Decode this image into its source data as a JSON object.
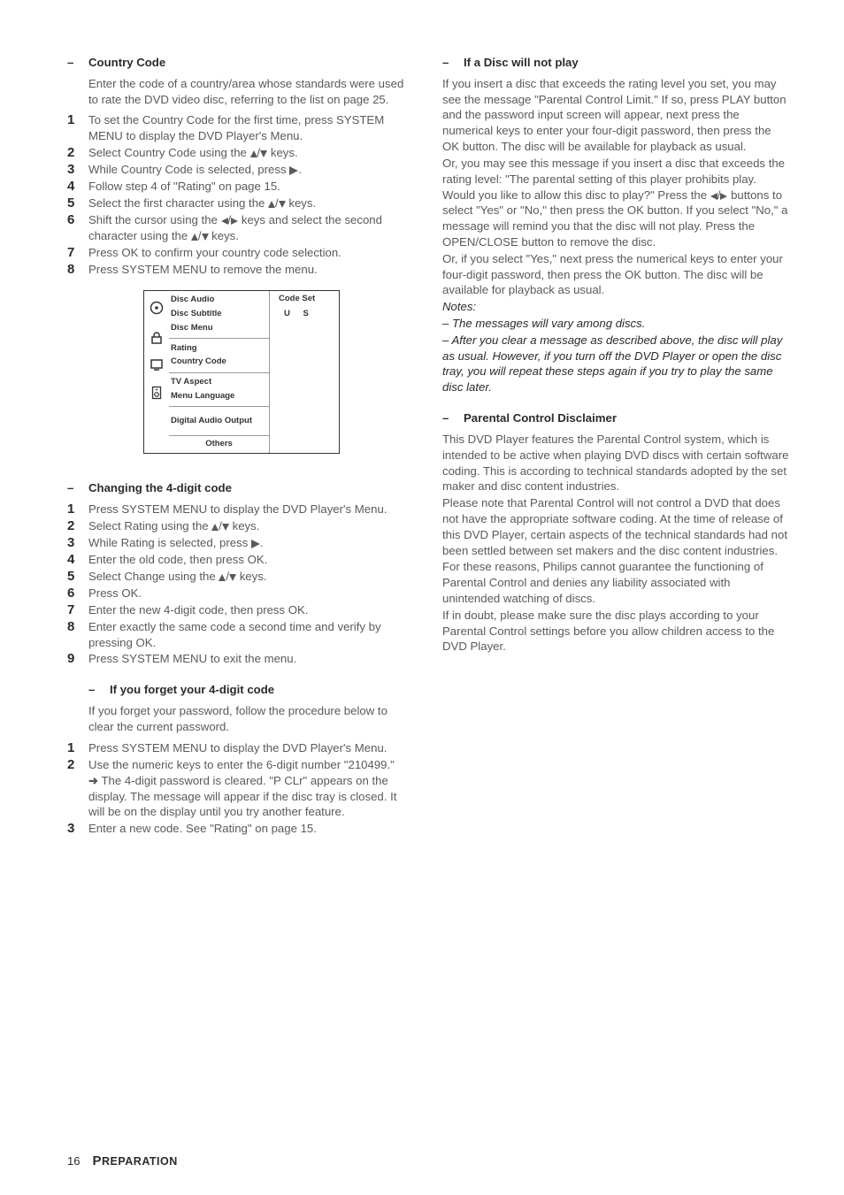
{
  "left": {
    "countryCode": {
      "heading": "Country Code",
      "intro": "Enter the code of a country/area whose standards were used to rate the DVD video disc, referring to the list  on page 25.",
      "steps": {
        "s1": "To set the Country Code for the first time, press SYSTEM MENU to display the DVD Player's Menu.",
        "s2a": "Select Country Code using the ",
        "s2b": " keys.",
        "s3a": "While Country Code is selected, press ",
        "s3b": ".",
        "s4": "Follow step 4 of \"Rating\" on page 15.",
        "s5a": "Select the first character using the ",
        "s5b": " keys.",
        "s6a": "Shift the cursor using the ",
        "s6b": " keys and select the second character using the ",
        "s6c": " keys.",
        "s7": "Press OK to confirm your country code selection.",
        "s8": "Press SYSTEM MENU to remove the menu."
      }
    },
    "menu": {
      "discAudio": "Disc Audio",
      "discSubtitle": "Disc Subtitle",
      "discMenu": "Disc Menu",
      "rating": "Rating",
      "countryCode": "Country Code",
      "tvAspect": "TV Aspect",
      "menuLanguage": "Menu Language",
      "digitalAudio": "Digital Audio Output",
      "others": "Others",
      "codeSet": "Code Set",
      "us": "U S"
    },
    "changing": {
      "heading": "Changing the 4-digit code",
      "s1": "Press SYSTEM MENU to display the DVD Player's Menu.",
      "s2a": "Select Rating using the ",
      "s2b": " keys.",
      "s3a": "While Rating is selected, press ",
      "s3b": ".",
      "s4": "Enter the old code, then press OK.",
      "s5a": "Select Change using the ",
      "s5b": " keys.",
      "s6": "Press OK.",
      "s7": "Enter the new 4-digit code, then press OK.",
      "s8": "Enter exactly the same code a second time and verify by pressing OK.",
      "s9": "Press SYSTEM MENU to exit the menu."
    },
    "forget": {
      "heading": "If you forget your 4-digit code",
      "intro": "If you forget your password, follow the procedure below to clear the current password.",
      "s1": "Press SYSTEM MENU to display the DVD Player's Menu.",
      "s2": "Use the numeric keys to enter the 6-digit number \"210499.\"",
      "s2res": " The 4-digit password is cleared. \"P CLr\" appears on the display. The message will appear if the disc tray is closed. It will be on the display until you try another feature.",
      "s3": "Enter a new code. See \"Rating\" on page 15."
    }
  },
  "right": {
    "disc": {
      "heading": "If a Disc will not play",
      "p1": "If you insert a disc that exceeds the rating level you set, you may see the message \"Parental Control Limit.\"  If so, press PLAY button and the password input screen will appear, next press the numerical keys to enter your four-digit password, then press the OK button. The disc will be available for playback as usual.",
      "p2a": "Or, you may see this message if you insert a disc that exceeds the rating level: \"The parental setting of this player prohibits play. Would you like to allow this disc to play?\" Press the ",
      "p2b": " buttons to select \"Yes\" or \"No,\"  then press the OK button. If you select \"No,\" a message will remind you that the disc will not play. Press the OPEN/CLOSE button to remove the disc.",
      "p3": "Or, if you select \"Yes,\" next press the numerical keys to enter your four-digit password, then press the OK button. The disc will be available for playback as usual.",
      "notesHead": "Notes:",
      "note1": "–  The messages will vary among discs.",
      "note2": "–  After you clear a message as described above, the disc will play as usual. However, if you turn off the DVD Player or open the disc tray, you will repeat these steps again if you try to play the same disc later."
    },
    "parental": {
      "heading": "Parental Control Disclaimer",
      "p1": "This DVD Player features the Parental Control system, which is intended to be active when playing DVD discs with certain software coding. This is according to technical standards adopted by the set maker and disc content industries.",
      "p2": "Please note that Parental Control will not control a DVD that does not have the appropriate software coding. At the time of release of this DVD Player, certain aspects of the technical standards had not been settled between set makers and the disc content industries.",
      "p3": "For these reasons, Philips cannot guarantee the functioning of Parental Control and denies any liability associated with unintended watching of discs.",
      "p4": "If in doubt, please make sure the disc plays according to your Parental Control settings before you allow children access to the DVD Player."
    }
  },
  "footer": {
    "page": "16",
    "sectionCap": "P",
    "sectionRest": "REPARATION"
  }
}
